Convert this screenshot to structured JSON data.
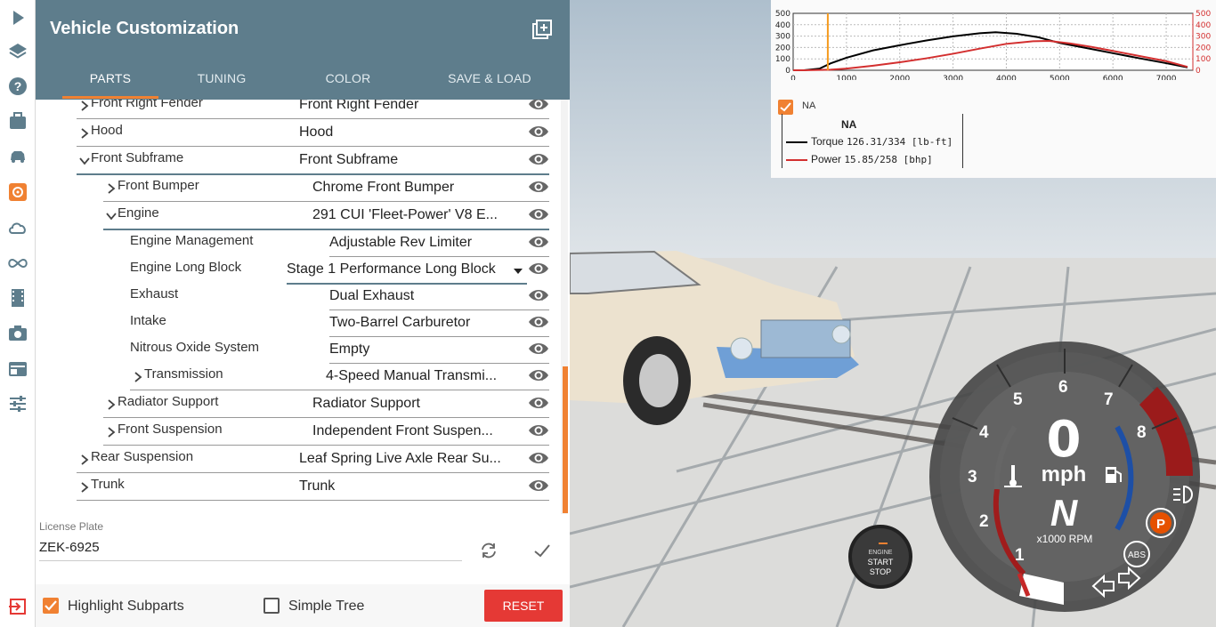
{
  "panel": {
    "title": "Vehicle Customization",
    "tabs": [
      {
        "label": "PARTS",
        "active": true
      },
      {
        "label": "TUNING",
        "active": false
      },
      {
        "label": "COLOR",
        "active": false
      },
      {
        "label": "SAVE & LOAD",
        "active": false
      }
    ]
  },
  "parts": [
    {
      "label": "Front Right Fender",
      "value": "Front Right Fender",
      "expander": "collapsed"
    },
    {
      "label": "Hood",
      "value": "Hood",
      "expander": "collapsed"
    },
    {
      "label": "Front Subframe",
      "value": "Front Subframe",
      "expander": "expanded"
    },
    {
      "label": "Front Bumper",
      "value": "Chrome Front Bumper",
      "expander": "collapsed"
    },
    {
      "label": "Engine",
      "value": "291 CUI 'Fleet-Power' V8 E...",
      "expander": "expanded"
    },
    {
      "label": "Engine Management",
      "value": "Adjustable Rev Limiter",
      "expander": "none"
    },
    {
      "label": "Engine Long Block",
      "value": "Stage 1 Performance Long Block",
      "expander": "none"
    },
    {
      "label": "Exhaust",
      "value": "Dual Exhaust",
      "expander": "none"
    },
    {
      "label": "Intake",
      "value": "Two-Barrel Carburetor",
      "expander": "none"
    },
    {
      "label": "Nitrous Oxide System",
      "value": "Empty",
      "expander": "none"
    },
    {
      "label": "Transmission",
      "value": "4-Speed Manual Transmi...",
      "expander": "collapsed"
    },
    {
      "label": "Radiator Support",
      "value": "Radiator Support",
      "expander": "collapsed"
    },
    {
      "label": "Front Suspension",
      "value": "Independent Front Suspen...",
      "expander": "collapsed"
    },
    {
      "label": "Rear Suspension",
      "value": "Leaf Spring Live Axle Rear Su...",
      "expander": "collapsed"
    },
    {
      "label": "Trunk",
      "value": "Trunk",
      "expander": "collapsed"
    }
  ],
  "license": {
    "label": "License Plate",
    "value": "ZEK-6925"
  },
  "footer": {
    "highlight_label": "Highlight Subparts",
    "highlight_checked": true,
    "simple_label": "Simple Tree",
    "simple_checked": false,
    "reset_label": "RESET"
  },
  "graph": {
    "left_ticks": [
      "500",
      "400",
      "300",
      "200",
      "100",
      "0"
    ],
    "right_ticks": [
      "500",
      "400",
      "300",
      "200",
      "100",
      "0"
    ],
    "x_ticks": [
      "0",
      "1000",
      "2000",
      "3000",
      "4000",
      "5000",
      "6000",
      "7000"
    ],
    "checkbox_label": "NA",
    "legend_title": "NA",
    "torque_label": "Torque",
    "torque_value": "126.31/334 [lb-ft]",
    "power_label": "Power",
    "power_value": "15.85/258  [bhp]",
    "current_rpm": 650,
    "torque_color": "#000000",
    "power_color": "#d32f2f",
    "marker_color": "#f59b1f"
  },
  "dashboard": {
    "speed": "0",
    "speed_unit": "mph",
    "gear": "N",
    "rpm_unit": "x1000 RPM",
    "rpm_numbers": [
      "1",
      "2",
      "3",
      "4",
      "5",
      "6",
      "7",
      "8"
    ],
    "engine_label": "ENGINE",
    "start_label": "START",
    "stop_label": "STOP",
    "parking_label": "P",
    "abs_label": "ABS"
  },
  "colors": {
    "accent": "#f08132",
    "header": "#5e7d8c",
    "reset": "#e53935"
  }
}
